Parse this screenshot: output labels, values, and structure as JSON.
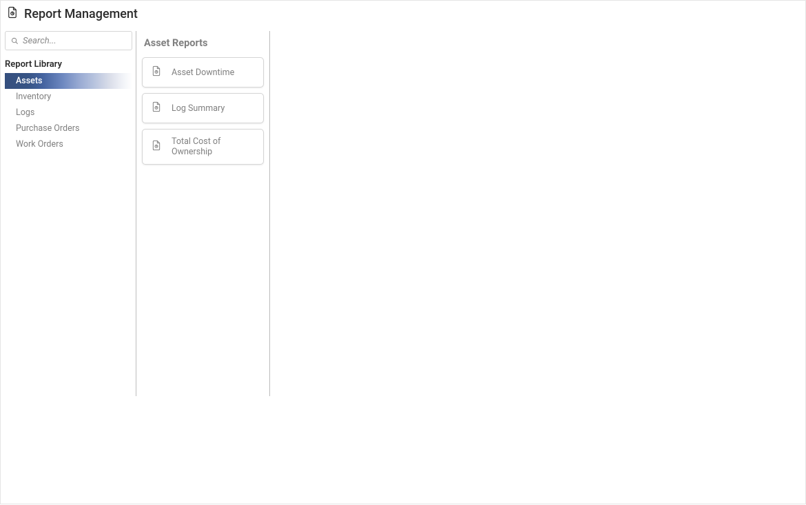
{
  "header": {
    "title": "Report Management"
  },
  "sidebar": {
    "search_placeholder": "Search...",
    "section_label": "Report Library",
    "items": [
      {
        "label": "Assets",
        "active": true
      },
      {
        "label": "Inventory",
        "active": false
      },
      {
        "label": "Logs",
        "active": false
      },
      {
        "label": "Purchase Orders",
        "active": false
      },
      {
        "label": "Work Orders",
        "active": false
      }
    ]
  },
  "reports_panel": {
    "title": "Asset Reports",
    "items": [
      {
        "label": "Asset Downtime"
      },
      {
        "label": "Log Summary"
      },
      {
        "label": "Total Cost of Ownership"
      }
    ]
  }
}
